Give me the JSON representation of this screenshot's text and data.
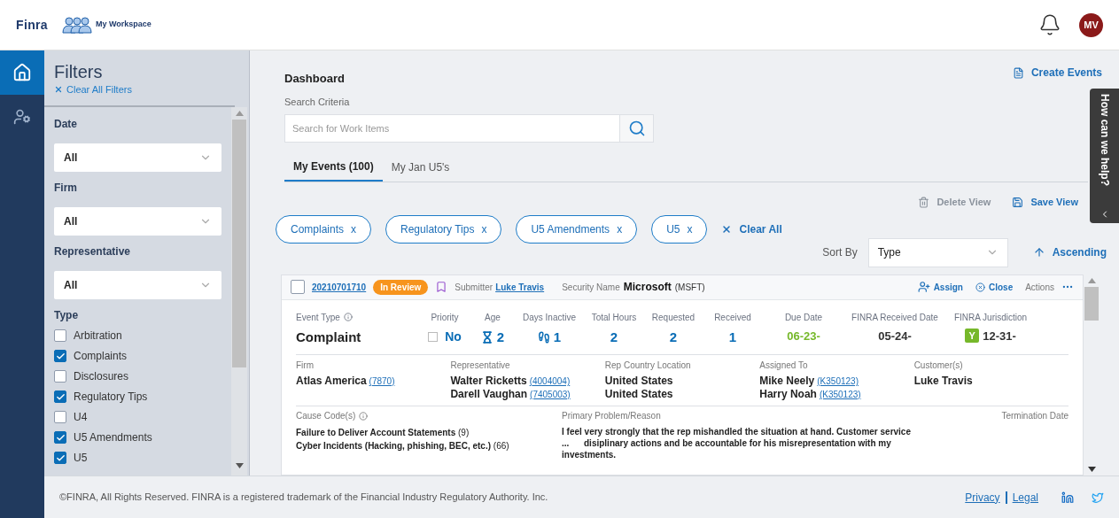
{
  "header": {
    "logo": "Finra",
    "app_name": "My Workspace",
    "avatar": "MV"
  },
  "nav": [
    {
      "kind": "home",
      "selected": true
    },
    {
      "kind": "user-settings",
      "selected": false
    }
  ],
  "filters": {
    "title": "Filters",
    "clear": "Clear All Filters",
    "dropdowns": [
      {
        "label": "Date",
        "value": "All"
      },
      {
        "label": "Firm",
        "value": "All"
      },
      {
        "label": "Representative",
        "value": "All"
      }
    ],
    "type_label": "Type",
    "types": [
      {
        "label": "Arbitration",
        "checked": false
      },
      {
        "label": "Complaints",
        "checked": true
      },
      {
        "label": "Disclosures",
        "checked": false
      },
      {
        "label": "Regulatory Tips",
        "checked": true
      },
      {
        "label": "U4",
        "checked": false
      },
      {
        "label": "U5 Amendments",
        "checked": true
      },
      {
        "label": "U5",
        "checked": true
      }
    ]
  },
  "main": {
    "title": "Dashboard",
    "create": "Create Events",
    "search_label": "Search Criteria",
    "search": {
      "placeholder": "Search for Work Items"
    },
    "tabs": [
      {
        "label": "My Events (100)",
        "selected": true
      },
      {
        "label": "My Jan U5's",
        "selected": false
      }
    ],
    "delete_view": "Delete View",
    "save_view": "Save View",
    "chips": [
      {
        "label": "Complaints",
        "remove": "x"
      },
      {
        "label": "Regulatory Tips",
        "remove": "x"
      },
      {
        "label": "U5 Amendments",
        "remove": "x"
      },
      {
        "label": "U5",
        "remove": "x"
      }
    ],
    "clear_all": "Clear All",
    "sort_label": "Sort By",
    "sort_value": "Type",
    "order": "Ascending"
  },
  "card": {
    "checked": false,
    "id": "20210701710",
    "status": "In Review",
    "submitter_label": "Submitter",
    "submitter": "Luke Travis",
    "security_label": "Security Name",
    "security": "Microsoft",
    "ticker": "(MSFT)",
    "assign": "Assign",
    "close": "Close",
    "actions": "Actions",
    "metrics": [
      {
        "kind": "title",
        "label": "Event Type",
        "value": "Complaint"
      },
      {
        "kind": "priority",
        "label": "Priority",
        "value": "No",
        "checked": false
      },
      {
        "kind": "age",
        "label": "Age",
        "value": "2"
      },
      {
        "kind": "inactive",
        "label": "Days Inactive",
        "value": "1"
      },
      {
        "kind": "plain",
        "label": "Total Hours",
        "value": "2"
      },
      {
        "kind": "plain",
        "label": "Requested",
        "value": "2"
      },
      {
        "kind": "plain",
        "label": "Received",
        "value": "1"
      },
      {
        "kind": "date",
        "label": "Due Date",
        "value": "06-23-",
        "color": "#76b82a"
      },
      {
        "kind": "date",
        "label": "FINRA Received Date",
        "value": "05-24-",
        "color": "#333333"
      },
      {
        "kind": "jurisdiction",
        "label": "FINRA Jurisdiction",
        "badge": "Y",
        "value": "12-31-"
      }
    ],
    "details": [
      {
        "label": "Firm",
        "lines": [
          {
            "name": "Atlas America",
            "code": "(7870)"
          }
        ]
      },
      {
        "label": "Representative",
        "lines": [
          {
            "name": "Walter Ricketts",
            "code": "(4004004)"
          },
          {
            "name": "Darell Vaughan",
            "code": "(7405003)"
          }
        ]
      },
      {
        "label": "Rep Country Location",
        "lines": [
          {
            "name": "United States"
          },
          {
            "name": "United States"
          }
        ]
      },
      {
        "label": "Assigned To",
        "lines": [
          {
            "name": "Mike Neely",
            "code": "(K350123)"
          },
          {
            "name": "Harry Noah",
            "code": "(K350123)"
          }
        ]
      },
      {
        "label": "Customer(s)",
        "lines": [
          {
            "name": "Luke Travis"
          }
        ]
      }
    ],
    "cause_label": "Cause Code(s)",
    "causes": [
      {
        "text": "Failure to Deliver Account Statements",
        "count": "(9)"
      },
      {
        "text": "Cyber Incidents (Hacking, phishing, BEC, etc.)",
        "count": "(66)"
      }
    ],
    "problem_label": "Primary Problem/Reason",
    "problem": "I feel very strongly that the rep mishandled the situation at hand. Customer service\n...      disiplinary actions and be accountable for his misrepresentation with my investments.",
    "termination_label": "Termination Date"
  },
  "help": "How can we help?",
  "footer": {
    "copyright": "©FINRA, All Rights Reserved. FINRA is a registered trademark of the Financial Industry Regulatory Authority. Inc.",
    "links": [
      "Privacy",
      "Legal"
    ]
  }
}
